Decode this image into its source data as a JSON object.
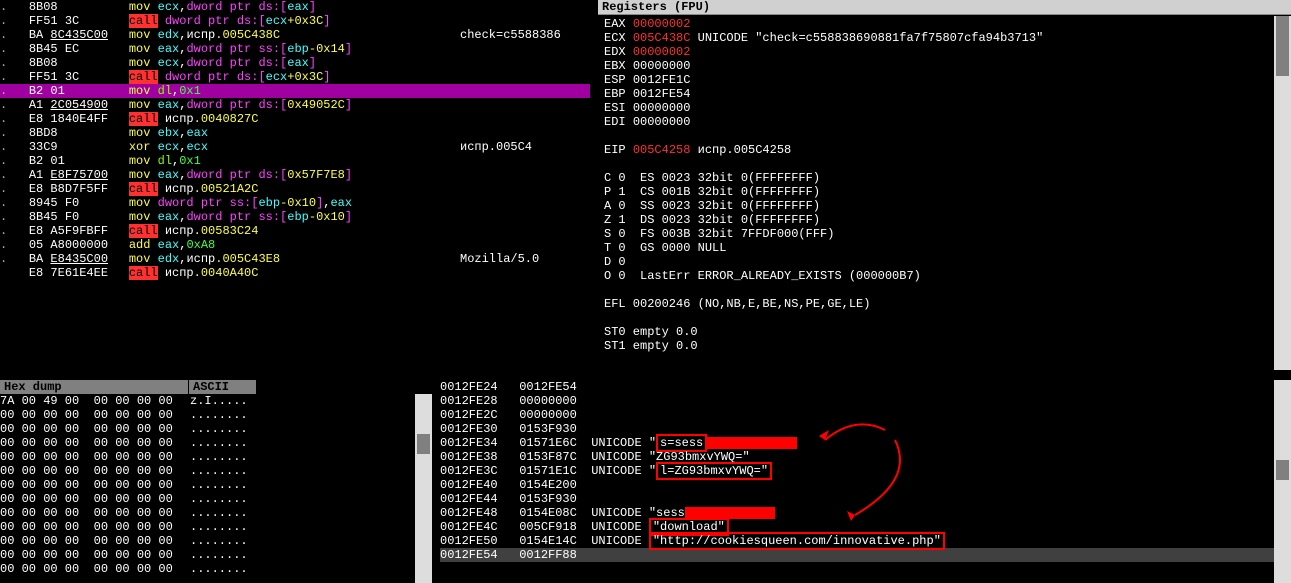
{
  "disasm": {
    "rows": [
      {
        "dot": ".",
        "b": "8B08",
        "op": "mov",
        "args": [
          {
            "t": "ecx",
            "c": "cyan"
          },
          {
            "t": ",",
            "c": "wht"
          },
          {
            "t": "dword ptr ds:[",
            "c": "mag"
          },
          {
            "t": "eax",
            "c": "cyan"
          },
          {
            "t": "]",
            "c": "mag"
          }
        ]
      },
      {
        "dot": ".",
        "b": "FF51 3C",
        "op": "call",
        "opc": "redbg",
        "args": [
          {
            "t": "dword ptr ds:[",
            "c": "mag"
          },
          {
            "t": "ecx",
            "c": "cyan"
          },
          {
            "t": "+0x3C",
            "c": "yel"
          },
          {
            "t": "]",
            "c": "mag"
          }
        ]
      },
      {
        "dot": ".",
        "b": "BA ",
        "b2": "8C435C00",
        "op": "mov",
        "args": [
          {
            "t": "edx",
            "c": "cyan"
          },
          {
            "t": ",",
            "c": "wht"
          },
          {
            "t": "испр",
            "c": "wht"
          },
          {
            "t": ".005C438C",
            "c": "yel"
          }
        ],
        "cmt": "check=c5588386"
      },
      {
        "dot": ".",
        "b": "8B45 EC",
        "op": "mov",
        "args": [
          {
            "t": "eax",
            "c": "cyan"
          },
          {
            "t": ",",
            "c": "wht"
          },
          {
            "t": "dword ptr ss:[",
            "c": "mag"
          },
          {
            "t": "ebp",
            "c": "cyan"
          },
          {
            "t": "-0x14",
            "c": "yel"
          },
          {
            "t": "]",
            "c": "mag"
          }
        ]
      },
      {
        "dot": ".",
        "b": "8B08",
        "op": "mov",
        "args": [
          {
            "t": "ecx",
            "c": "cyan"
          },
          {
            "t": ",",
            "c": "wht"
          },
          {
            "t": "dword ptr ds:[",
            "c": "mag"
          },
          {
            "t": "eax",
            "c": "cyan"
          },
          {
            "t": "]",
            "c": "mag"
          }
        ]
      },
      {
        "dot": ".",
        "b": "FF51 3C",
        "op": "call",
        "opc": "redbg",
        "args": [
          {
            "t": "dword ptr ds:[",
            "c": "mag"
          },
          {
            "t": "ecx",
            "c": "cyan"
          },
          {
            "t": "+0x3C",
            "c": "yel"
          },
          {
            "t": "]",
            "c": "mag"
          }
        ]
      },
      {
        "dot": ".",
        "b": "B2 01",
        "hl": true,
        "op": "mov",
        "args": [
          {
            "t": "dl",
            "c": "lime"
          },
          {
            "t": ",",
            "c": "wht"
          },
          {
            "t": "0x1",
            "c": "grn"
          }
        ]
      },
      {
        "dot": ".",
        "b": "A1 ",
        "b2": "2C054900",
        "op": "mov",
        "args": [
          {
            "t": "eax",
            "c": "cyan"
          },
          {
            "t": ",",
            "c": "wht"
          },
          {
            "t": "dword ptr ds:[",
            "c": "mag"
          },
          {
            "t": "0x49052C",
            "c": "yel"
          },
          {
            "t": "]",
            "c": "mag"
          }
        ]
      },
      {
        "dot": ".",
        "b": "E8 1840E4FF",
        "op": "call",
        "opc": "redbg",
        "args": [
          {
            "t": "испр",
            "c": "wht"
          },
          {
            "t": ".0040827C",
            "c": "yel"
          }
        ]
      },
      {
        "dot": ".",
        "b": "8BD8",
        "op": "mov",
        "args": [
          {
            "t": "ebx",
            "c": "cyan"
          },
          {
            "t": ",",
            "c": "wht"
          },
          {
            "t": "eax",
            "c": "cyan"
          }
        ]
      },
      {
        "dot": ".",
        "b": "33C9",
        "op": "xor",
        "args": [
          {
            "t": "ecx",
            "c": "cyan"
          },
          {
            "t": ",",
            "c": "wht"
          },
          {
            "t": "ecx",
            "c": "cyan"
          }
        ],
        "cmt": "испр.005C4"
      },
      {
        "dot": ".",
        "b": "B2 01",
        "op": "mov",
        "args": [
          {
            "t": "dl",
            "c": "lime"
          },
          {
            "t": ",",
            "c": "wht"
          },
          {
            "t": "0x1",
            "c": "grn"
          }
        ]
      },
      {
        "dot": ".",
        "b": "A1 ",
        "b2": "E8F75700",
        "op": "mov",
        "args": [
          {
            "t": "eax",
            "c": "cyan"
          },
          {
            "t": ",",
            "c": "wht"
          },
          {
            "t": "dword ptr ds:[",
            "c": "mag"
          },
          {
            "t": "0x57F7E8",
            "c": "yel"
          },
          {
            "t": "]",
            "c": "mag"
          }
        ]
      },
      {
        "dot": ".",
        "b": "E8 B8D7F5FF",
        "op": "call",
        "opc": "redbg",
        "args": [
          {
            "t": "испр",
            "c": "wht"
          },
          {
            "t": ".00521A2C",
            "c": "yel"
          }
        ]
      },
      {
        "dot": ".",
        "b": "8945 F0",
        "op": "mov",
        "args": [
          {
            "t": "dword ptr ss:[",
            "c": "mag"
          },
          {
            "t": "ebp",
            "c": "cyan"
          },
          {
            "t": "-0x10",
            "c": "yel"
          },
          {
            "t": "]",
            "c": "mag"
          },
          {
            "t": ",",
            "c": "wht"
          },
          {
            "t": "eax",
            "c": "cyan"
          }
        ]
      },
      {
        "dot": ".",
        "b": "8B45 F0",
        "op": "mov",
        "args": [
          {
            "t": "eax",
            "c": "cyan"
          },
          {
            "t": ",",
            "c": "wht"
          },
          {
            "t": "dword ptr ss:[",
            "c": "mag"
          },
          {
            "t": "ebp",
            "c": "cyan"
          },
          {
            "t": "-0x10",
            "c": "yel"
          },
          {
            "t": "]",
            "c": "mag"
          }
        ]
      },
      {
        "dot": ".",
        "b": "E8 A5F9FBFF",
        "op": "call",
        "opc": "redbg",
        "args": [
          {
            "t": "испр",
            "c": "wht"
          },
          {
            "t": ".00583C24",
            "c": "yel"
          }
        ]
      },
      {
        "dot": ".",
        "b": "05 A8000000",
        "op": "add",
        "args": [
          {
            "t": "eax",
            "c": "cyan"
          },
          {
            "t": ",",
            "c": "wht"
          },
          {
            "t": "0xA8",
            "c": "grn"
          }
        ]
      },
      {
        "dot": ".",
        "b": "BA ",
        "b2": "E8435C00",
        "op": "mov",
        "args": [
          {
            "t": "edx",
            "c": "cyan"
          },
          {
            "t": ",",
            "c": "wht"
          },
          {
            "t": "испр",
            "c": "wht"
          },
          {
            "t": ".005C43E8",
            "c": "yel"
          }
        ],
        "cmt": "Mozilla/5.0"
      },
      {
        "dot": " ",
        "b": "E8 7E61E4EE",
        "op": "call",
        "opc": "redbg",
        "args": [
          {
            "t": "испр",
            "c": "wht"
          },
          {
            "t": ".0040A40C",
            "c": "yel"
          }
        ]
      }
    ]
  },
  "registers": {
    "title": "Registers (FPU)",
    "gp": [
      {
        "n": "EAX",
        "v": "00000002",
        "vc": "red"
      },
      {
        "n": "ECX",
        "v": "005C438C",
        "vc": "red",
        "extra": "UNICODE \"check=c558838690881fa7f75807cfa94b3713\""
      },
      {
        "n": "EDX",
        "v": "00000002",
        "vc": "red"
      },
      {
        "n": "EBX",
        "v": "00000000"
      },
      {
        "n": "ESP",
        "v": "0012FE1C"
      },
      {
        "n": "EBP",
        "v": "0012FE54"
      },
      {
        "n": "ESI",
        "v": "00000000"
      },
      {
        "n": "EDI",
        "v": "00000000"
      }
    ],
    "eip": {
      "n": "EIP",
      "v": "005C4258",
      "extra": "испр.005C4258"
    },
    "flags": [
      {
        "n": "C",
        "v": "0",
        "seg": "ES",
        "sv": "0023 32bit 0(FFFFFFFF)"
      },
      {
        "n": "P",
        "v": "1",
        "seg": "CS",
        "sv": "001B 32bit 0(FFFFFFFF)"
      },
      {
        "n": "A",
        "v": "0",
        "seg": "SS",
        "sv": "0023 32bit 0(FFFFFFFF)"
      },
      {
        "n": "Z",
        "v": "1",
        "seg": "DS",
        "sv": "0023 32bit 0(FFFFFFFF)"
      },
      {
        "n": "S",
        "v": "0",
        "seg": "FS",
        "sv": "003B 32bit 7FFDF000(FFF)"
      },
      {
        "n": "T",
        "v": "0",
        "seg": "GS",
        "sv": "0000 NULL"
      },
      {
        "n": "D",
        "v": "0"
      },
      {
        "n": "O",
        "v": "0",
        "extra": "LastErr ERROR_ALREADY_EXISTS (000000B7)"
      }
    ],
    "efl": "EFL 00200246 (NO,NB,E,BE,NS,PE,GE,LE)",
    "fpu": [
      "ST0 empty 0.0",
      "ST1 empty 0.0"
    ]
  },
  "hex": {
    "h1": "Hex dump",
    "h2": "ASCII",
    "rows": [
      {
        "b": "7A 00 49 00 00 00 00 00",
        "a": "z.I....."
      },
      {
        "b": "00 00 00 00 00 00 00 00",
        "a": "........"
      },
      {
        "b": "00 00 00 00 00 00 00 00",
        "a": "........"
      },
      {
        "b": "00 00 00 00 00 00 00 00",
        "a": "........"
      },
      {
        "b": "00 00 00 00 00 00 00 00",
        "a": "........"
      },
      {
        "b": "00 00 00 00 00 00 00 00",
        "a": "........"
      },
      {
        "b": "00 00 00 00 00 00 00 00",
        "a": "........"
      },
      {
        "b": "00 00 00 00 00 00 00 00",
        "a": "........"
      },
      {
        "b": "00 00 00 00 00 00 00 00",
        "a": "........"
      },
      {
        "b": "00 00 00 00 00 00 00 00",
        "a": "........"
      },
      {
        "b": "00 00 00 00 00 00 00 00",
        "a": "........"
      },
      {
        "b": "00 00 00 00 00 00 00 00",
        "a": "........"
      },
      {
        "b": "00 00 00 00 00 00 00 00",
        "a": "........"
      }
    ]
  },
  "stack": {
    "rows": [
      {
        "a": "0012FE24",
        "v": "0012FE54"
      },
      {
        "a": "0012FE28",
        "v": "00000000"
      },
      {
        "a": "0012FE2C",
        "v": "00000000"
      },
      {
        "a": "0012FE30",
        "v": "0153F930"
      },
      {
        "a": "0012FE34",
        "v": "01571E6C",
        "u": "UNICODE \"",
        "box": "s=sess",
        "redact": true
      },
      {
        "a": "0012FE38",
        "v": "0153F87C",
        "u": "UNICODE \"ZG93bmxvYWQ=\""
      },
      {
        "a": "0012FE3C",
        "v": "01571E1C",
        "u": "UNICODE \"",
        "box": "l=ZG93bmxvYWQ=\""
      },
      {
        "a": "0012FE40",
        "v": "0154E200"
      },
      {
        "a": "0012FE44",
        "v": "0153F930"
      },
      {
        "a": "0012FE48",
        "v": "0154E08C",
        "u": "UNICODE \"sess",
        "redact": true
      },
      {
        "a": "0012FE4C",
        "v": "005CF918",
        "u": "UNICODE ",
        "box": "\"download\""
      },
      {
        "a": "0012FE50",
        "v": "0154E14C",
        "u": "UNICODE ",
        "box": "\"http://cookiesqueen.com/innovative.php\""
      },
      {
        "a": "0012FE54",
        "v": "0012FF88",
        "sel": true
      }
    ]
  }
}
